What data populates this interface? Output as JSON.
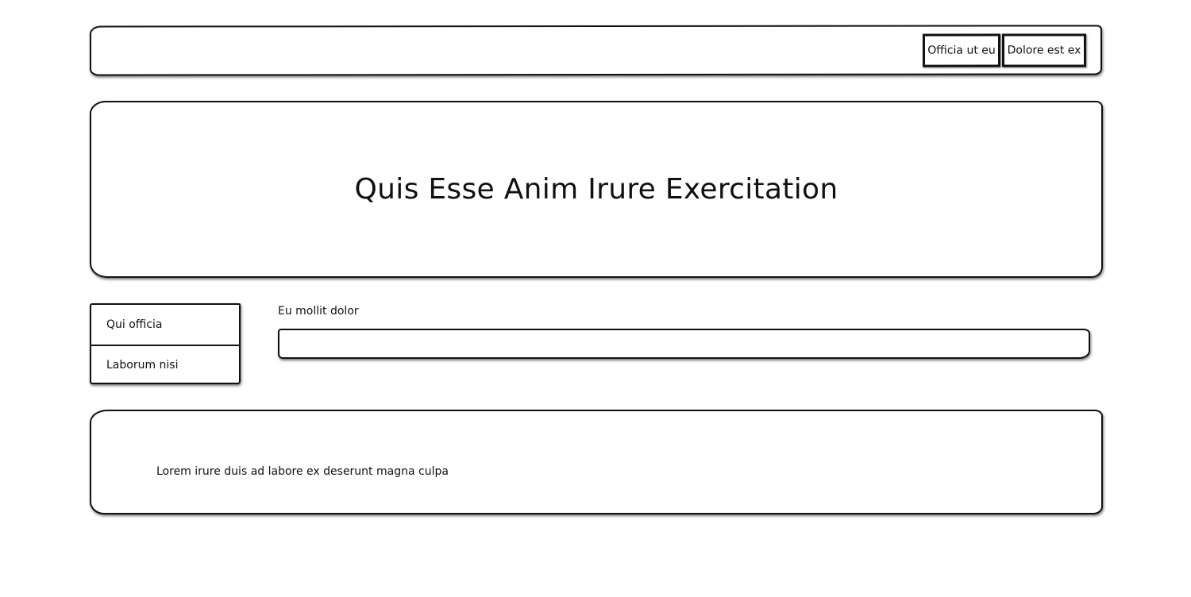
{
  "header": {
    "nav": [
      {
        "label": "Officia ut eu"
      },
      {
        "label": "Dolore est ex"
      }
    ]
  },
  "hero": {
    "title": "Quis Esse Anim Irure Exercitation"
  },
  "sidebar": {
    "items": [
      {
        "label": "Qui officia"
      },
      {
        "label": "Laborum nisi"
      }
    ]
  },
  "form": {
    "label": "Eu mollit dolor",
    "value": ""
  },
  "footer": {
    "text": "Lorem irure duis ad labore ex deserunt magna culpa"
  }
}
